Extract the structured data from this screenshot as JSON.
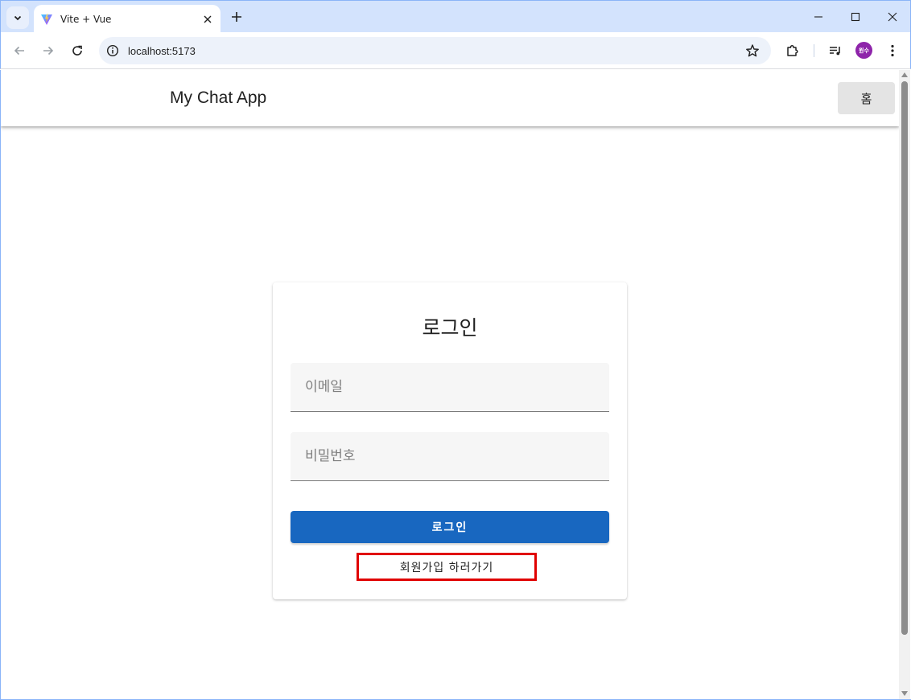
{
  "browser": {
    "tab_title": "Vite + Vue",
    "url": "localhost:5173",
    "profile_initials": "원수"
  },
  "appbar": {
    "title": "My Chat App",
    "home_label": "홈"
  },
  "login": {
    "title": "로그인",
    "email_placeholder": "이메일",
    "password_placeholder": "비밀번호",
    "submit_label": "로그인",
    "signup_link": "회원가입 하러가기"
  },
  "colors": {
    "primary": "#1867c0",
    "highlight_box": "#e00000",
    "tabstrip": "#d3e3fd"
  },
  "icons": {
    "tab_search": "chevron-down-icon",
    "favicon": "vite-logo-icon",
    "tab_close": "close-icon",
    "new_tab": "plus-icon",
    "back": "arrow-left-icon",
    "forward": "arrow-right-icon",
    "reload": "reload-icon",
    "site_info": "info-icon",
    "bookmark": "star-icon",
    "extensions": "puzzle-icon",
    "media": "media-queue-icon",
    "menu": "kebab-menu-icon"
  }
}
